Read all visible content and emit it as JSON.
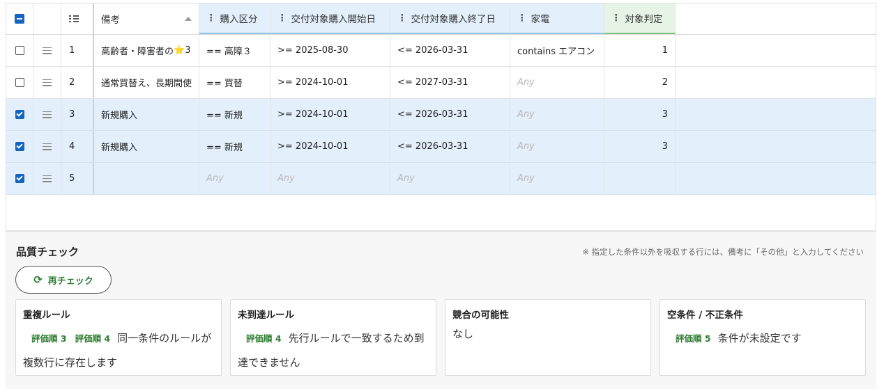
{
  "columns": {
    "note": "備考",
    "kubun": "購入区分",
    "start": "交付対象購入開始日",
    "end": "交付対象購入終了日",
    "kaden": "家電",
    "judge": "対象判定"
  },
  "rows": [
    {
      "checked": false,
      "num": "1",
      "note": "高齢者・障害者の",
      "note_star": "⭐",
      "note_tail": "3",
      "kubun": "== 高障３",
      "start": ">= 2025-08-30",
      "end": "<= 2026-03-31",
      "kaden": "contains エアコン",
      "judge": "1"
    },
    {
      "checked": false,
      "num": "2",
      "note": "通常買替え、長期間使",
      "kubun": "== 買替",
      "start": ">= 2024-10-01",
      "end": "<= 2027-03-31",
      "kaden": "Any",
      "judge": "2"
    },
    {
      "checked": true,
      "num": "3",
      "note": "新規購入",
      "kubun": "== 新規",
      "start": ">= 2024-10-01",
      "end": "<= 2026-03-31",
      "kaden": "Any",
      "judge": "3"
    },
    {
      "checked": true,
      "num": "4",
      "note": "新規購入",
      "kubun": "== 新規",
      "start": ">= 2024-10-01",
      "end": "<= 2026-03-31",
      "kaden": "Any",
      "judge": "3"
    },
    {
      "checked": true,
      "num": "5",
      "note": "",
      "kubun": "Any",
      "start": "Any",
      "end": "Any",
      "kaden": "Any",
      "judge": ""
    }
  ],
  "quality": {
    "title": "品質チェック",
    "note": "※ 指定した条件以外を吸収する行には、備考に「その他」と入力してください",
    "recheck_label": "再チェック",
    "cards": [
      {
        "title": "重複ルール",
        "tags": [
          "評価順 3",
          "評価順 4"
        ],
        "text": "同一条件のルールが複数行に存在します"
      },
      {
        "title": "未到達ルール",
        "tags": [
          "評価順 4"
        ],
        "text": "先行ルールで一致するため到達できません"
      },
      {
        "title": "競合の可能性",
        "tags": [],
        "text": "なし"
      },
      {
        "title": "空条件 / 不正条件",
        "tags": [
          "評価順 5"
        ],
        "text": "条件が未設定です"
      }
    ]
  },
  "colors": {
    "accent_blue": "#1565c0",
    "selected_row": "#e3f0fc",
    "judge_header": "#e6f4e6",
    "tag_green": "#2e7d32"
  },
  "icons": {
    "select_all": "indeterminate-checkbox-icon",
    "row_number": "list-numbered-icon",
    "drag": "drag-handle-icon",
    "sort": "sort-ascending-icon",
    "recheck": "refresh-icon"
  }
}
